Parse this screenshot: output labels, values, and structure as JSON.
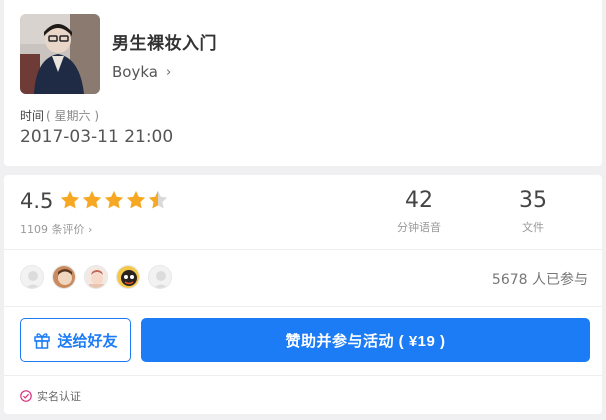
{
  "event": {
    "title": "男生裸妆入门",
    "author": "Boyka",
    "author_chevron": "›",
    "time_label": "时间",
    "time_week": "( 星期六 )",
    "time_value": "2017-03-11 21:00"
  },
  "rating": {
    "score": "4.5",
    "stars": 4.5,
    "review_count": "1109 条评价 ›",
    "star_color": "#f7a823"
  },
  "stats": [
    {
      "value": "42",
      "label": "分钟语音"
    },
    {
      "value": "35",
      "label": "文件"
    }
  ],
  "participants": {
    "text": "5678 人已参与"
  },
  "actions": {
    "gift_label": "送给好友",
    "join_label": "赞助并参与活动 ( ¥19 )",
    "accent": "#1b7cf5"
  },
  "verification": {
    "label": "实名认证",
    "color": "#d6317c"
  }
}
